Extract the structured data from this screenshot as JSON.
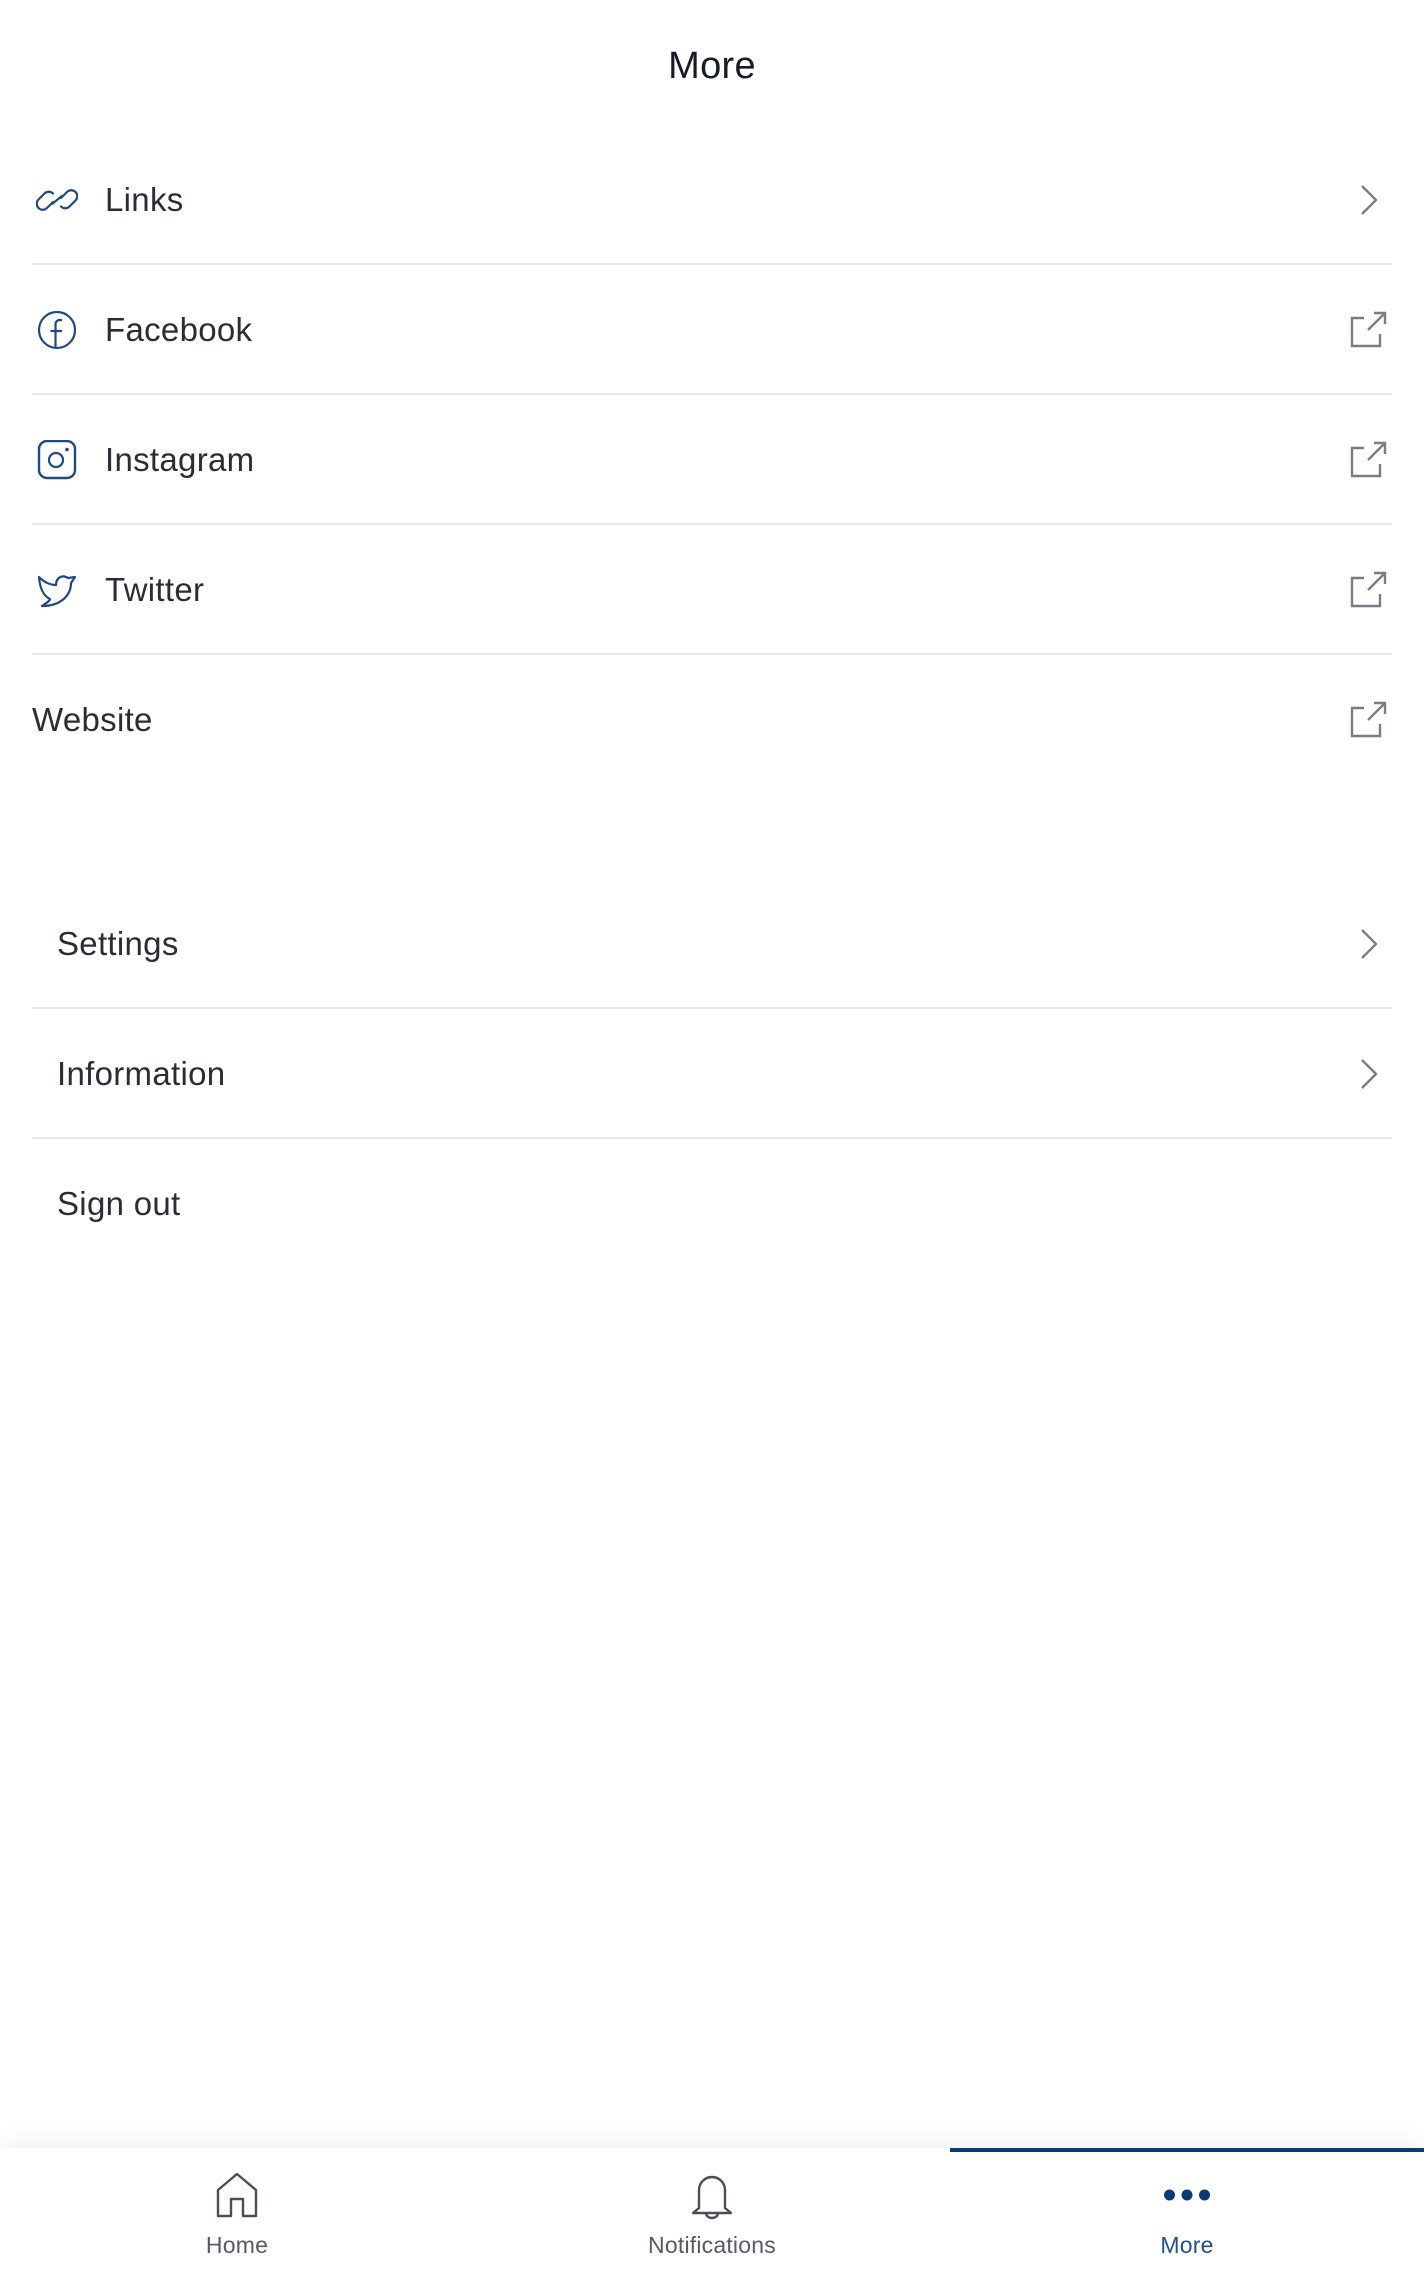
{
  "header": {
    "title": "More"
  },
  "social_links": [
    {
      "label": "Links",
      "icon": "link-icon",
      "trailing": "chevron-right-icon"
    },
    {
      "label": "Facebook",
      "icon": "facebook-icon",
      "trailing": "external-link-icon"
    },
    {
      "label": "Instagram",
      "icon": "instagram-icon",
      "trailing": "external-link-icon"
    },
    {
      "label": "Twitter",
      "icon": "twitter-icon",
      "trailing": "external-link-icon"
    },
    {
      "label": "Website",
      "icon": null,
      "trailing": "external-link-icon"
    }
  ],
  "account_items": [
    {
      "label": "Settings",
      "trailing": "chevron-right-icon"
    },
    {
      "label": "Information",
      "trailing": "chevron-right-icon"
    },
    {
      "label": "Sign out",
      "trailing": null
    }
  ],
  "tabbar": {
    "tabs": [
      {
        "label": "Home",
        "icon": "home-icon",
        "active": false
      },
      {
        "label": "Notifications",
        "icon": "bell-icon",
        "active": false
      },
      {
        "label": "More",
        "icon": "more-dots-icon",
        "active": true
      }
    ]
  },
  "colors": {
    "accent": "#0b3a78",
    "icon_navy": "#1f4a80",
    "text": "#2a2d38",
    "muted_icon": "#7a7d85",
    "divider": "#e8e8ea"
  }
}
